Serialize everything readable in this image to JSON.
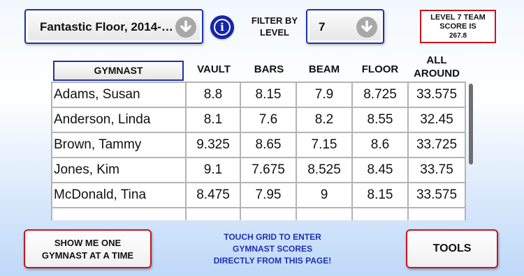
{
  "header": {
    "meet_select": "Fantastic Floor, 2014-…",
    "filter_label_line1": "FILTER BY",
    "filter_label_line2": "LEVEL",
    "level_select": "7",
    "team_score_line1": "LEVEL 7 TEAM",
    "team_score_line2": "SCORE IS",
    "team_score_value": "267.8"
  },
  "columns": {
    "gymnast": "GYMNAST",
    "vault": "VAULT",
    "bars": "BARS",
    "beam": "BEAM",
    "floor": "FLOOR",
    "all_around_line1": "ALL",
    "all_around_line2": "AROUND"
  },
  "rows": [
    {
      "name": "Adams, Susan",
      "vault": "8.8",
      "bars": "8.15",
      "beam": "7.9",
      "floor": "8.725",
      "aa": "33.575"
    },
    {
      "name": "Anderson, Linda",
      "vault": "8.1",
      "bars": "7.6",
      "beam": "8.2",
      "floor": "8.55",
      "aa": "32.45"
    },
    {
      "name": "Brown, Tammy",
      "vault": "9.325",
      "bars": "8.65",
      "beam": "7.15",
      "floor": "8.6",
      "aa": "33.725"
    },
    {
      "name": "Jones, Kim",
      "vault": "9.1",
      "bars": "7.675",
      "beam": "8.525",
      "floor": "8.45",
      "aa": "33.75"
    },
    {
      "name": "McDonald, Tina",
      "vault": "8.475",
      "bars": "7.95",
      "beam": "9",
      "floor": "8.15",
      "aa": "33.575"
    }
  ],
  "footer": {
    "show_one_line1": "SHOW ME ONE",
    "show_one_line2": "GYMNAST AT A TIME",
    "hint_line1": "TOUCH GRID TO ENTER",
    "hint_line2": "GYMNAST SCORES",
    "hint_line3": "DIRECTLY FROM THIS PAGE!",
    "tools_label": "TOOLS"
  },
  "icons": {
    "dropdown": "chevron-down-icon",
    "info": "info-icon"
  },
  "colors": {
    "accent_blue": "#1f32a8",
    "accent_red": "#c8141e",
    "hint_blue": "#1f2fb3"
  }
}
